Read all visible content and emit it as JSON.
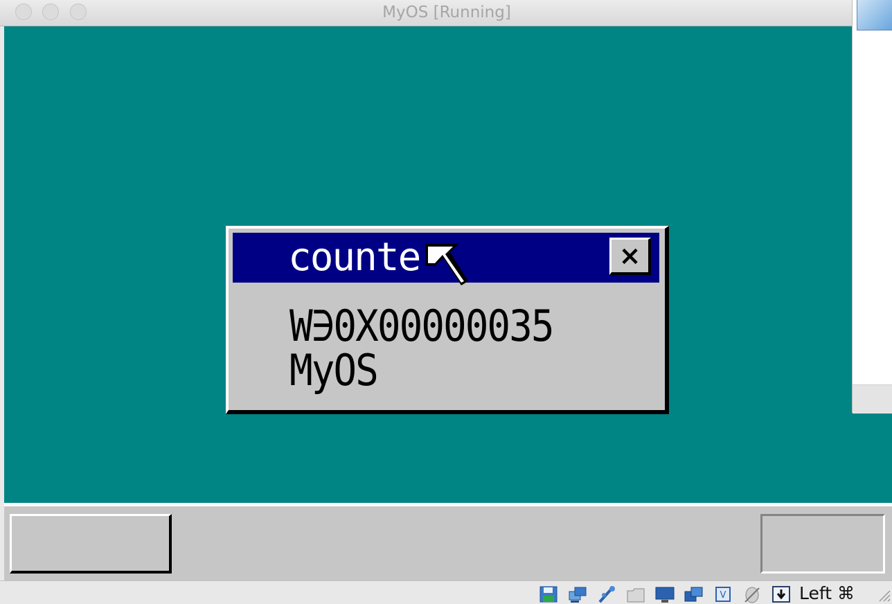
{
  "window": {
    "title": "MyOS [Running]"
  },
  "guest_window": {
    "title": "counte",
    "close_label": "×",
    "lines": [
      "W∋0X00000035",
      "MyOS"
    ]
  },
  "statusbar": {
    "host_key": "Left ⌘"
  },
  "icons": [
    "floppy-disk-icon",
    "network-icon",
    "usb-icon",
    "shared-folder-icon",
    "display-icon",
    "screen-capture-icon",
    "cpu-icon",
    "mouse-integration-icon",
    "host-key-download-icon"
  ],
  "colors": {
    "desktop": "#008484",
    "guest_title_bar": "#000084",
    "guest_face": "#c6c6c6"
  }
}
